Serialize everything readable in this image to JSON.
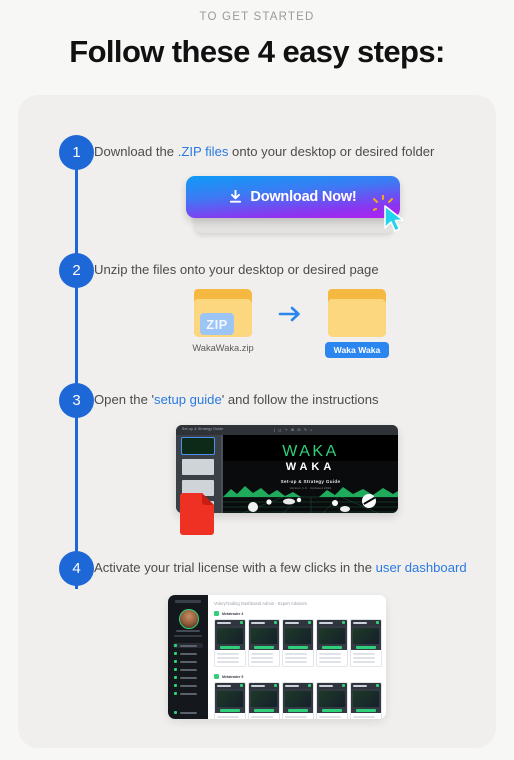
{
  "header": {
    "overline": "TO GET STARTED",
    "title": "Follow these 4 easy steps:"
  },
  "colors": {
    "page_bg": "#f7f7f6",
    "card_bg": "#f0efed",
    "accent_blue": "#1d68d6",
    "link_blue": "#2a7ae2",
    "button_gradient_start": "#0f9bf6",
    "button_gradient_end": "#b41ff2",
    "cursor_cyan": "#22d3ee",
    "pdf_red": "#ef3124",
    "folder_orange": "#fcd77f",
    "dashboard_green": "#2fd07a"
  },
  "steps": [
    {
      "number": "1",
      "text_before": "Download the ",
      "link": ".ZIP files",
      "text_after": " onto your desktop or desired folder"
    },
    {
      "number": "2",
      "text_before": "Unzip the files onto your desktop or desired page",
      "link": "",
      "text_after": ""
    },
    {
      "number": "3",
      "text_before": "Open the '",
      "link": "setup guide",
      "text_after": "' and follow the instructions"
    },
    {
      "number": "4",
      "text_before": "Activate your trial license with a few clicks in the ",
      "link": "user dashboard",
      "text_after": ""
    }
  ],
  "download_button": {
    "label": "Download Now!",
    "icon": "download-icon"
  },
  "unzip": {
    "zip_badge": "ZIP",
    "zip_caption": "WakaWaka.zip",
    "folder_pill": "Waka Waka",
    "arrow_icon": "arrow-right-icon"
  },
  "setup_guide": {
    "pdf_badge": "PDF",
    "slide_brand_line1": "WAKA",
    "slide_brand_line2": "WAKA",
    "slide_subtitle": "Set-up & Strategy Guide",
    "slide_subtitle2": "Version 1.0 · Updated 2024"
  },
  "dashboard": {
    "title": "VoleryTrading Dashboard Admin",
    "title_suffix": " - Expert Advisors",
    "section_1": "Metatrader 4",
    "section_2": "Metatrader 5"
  }
}
